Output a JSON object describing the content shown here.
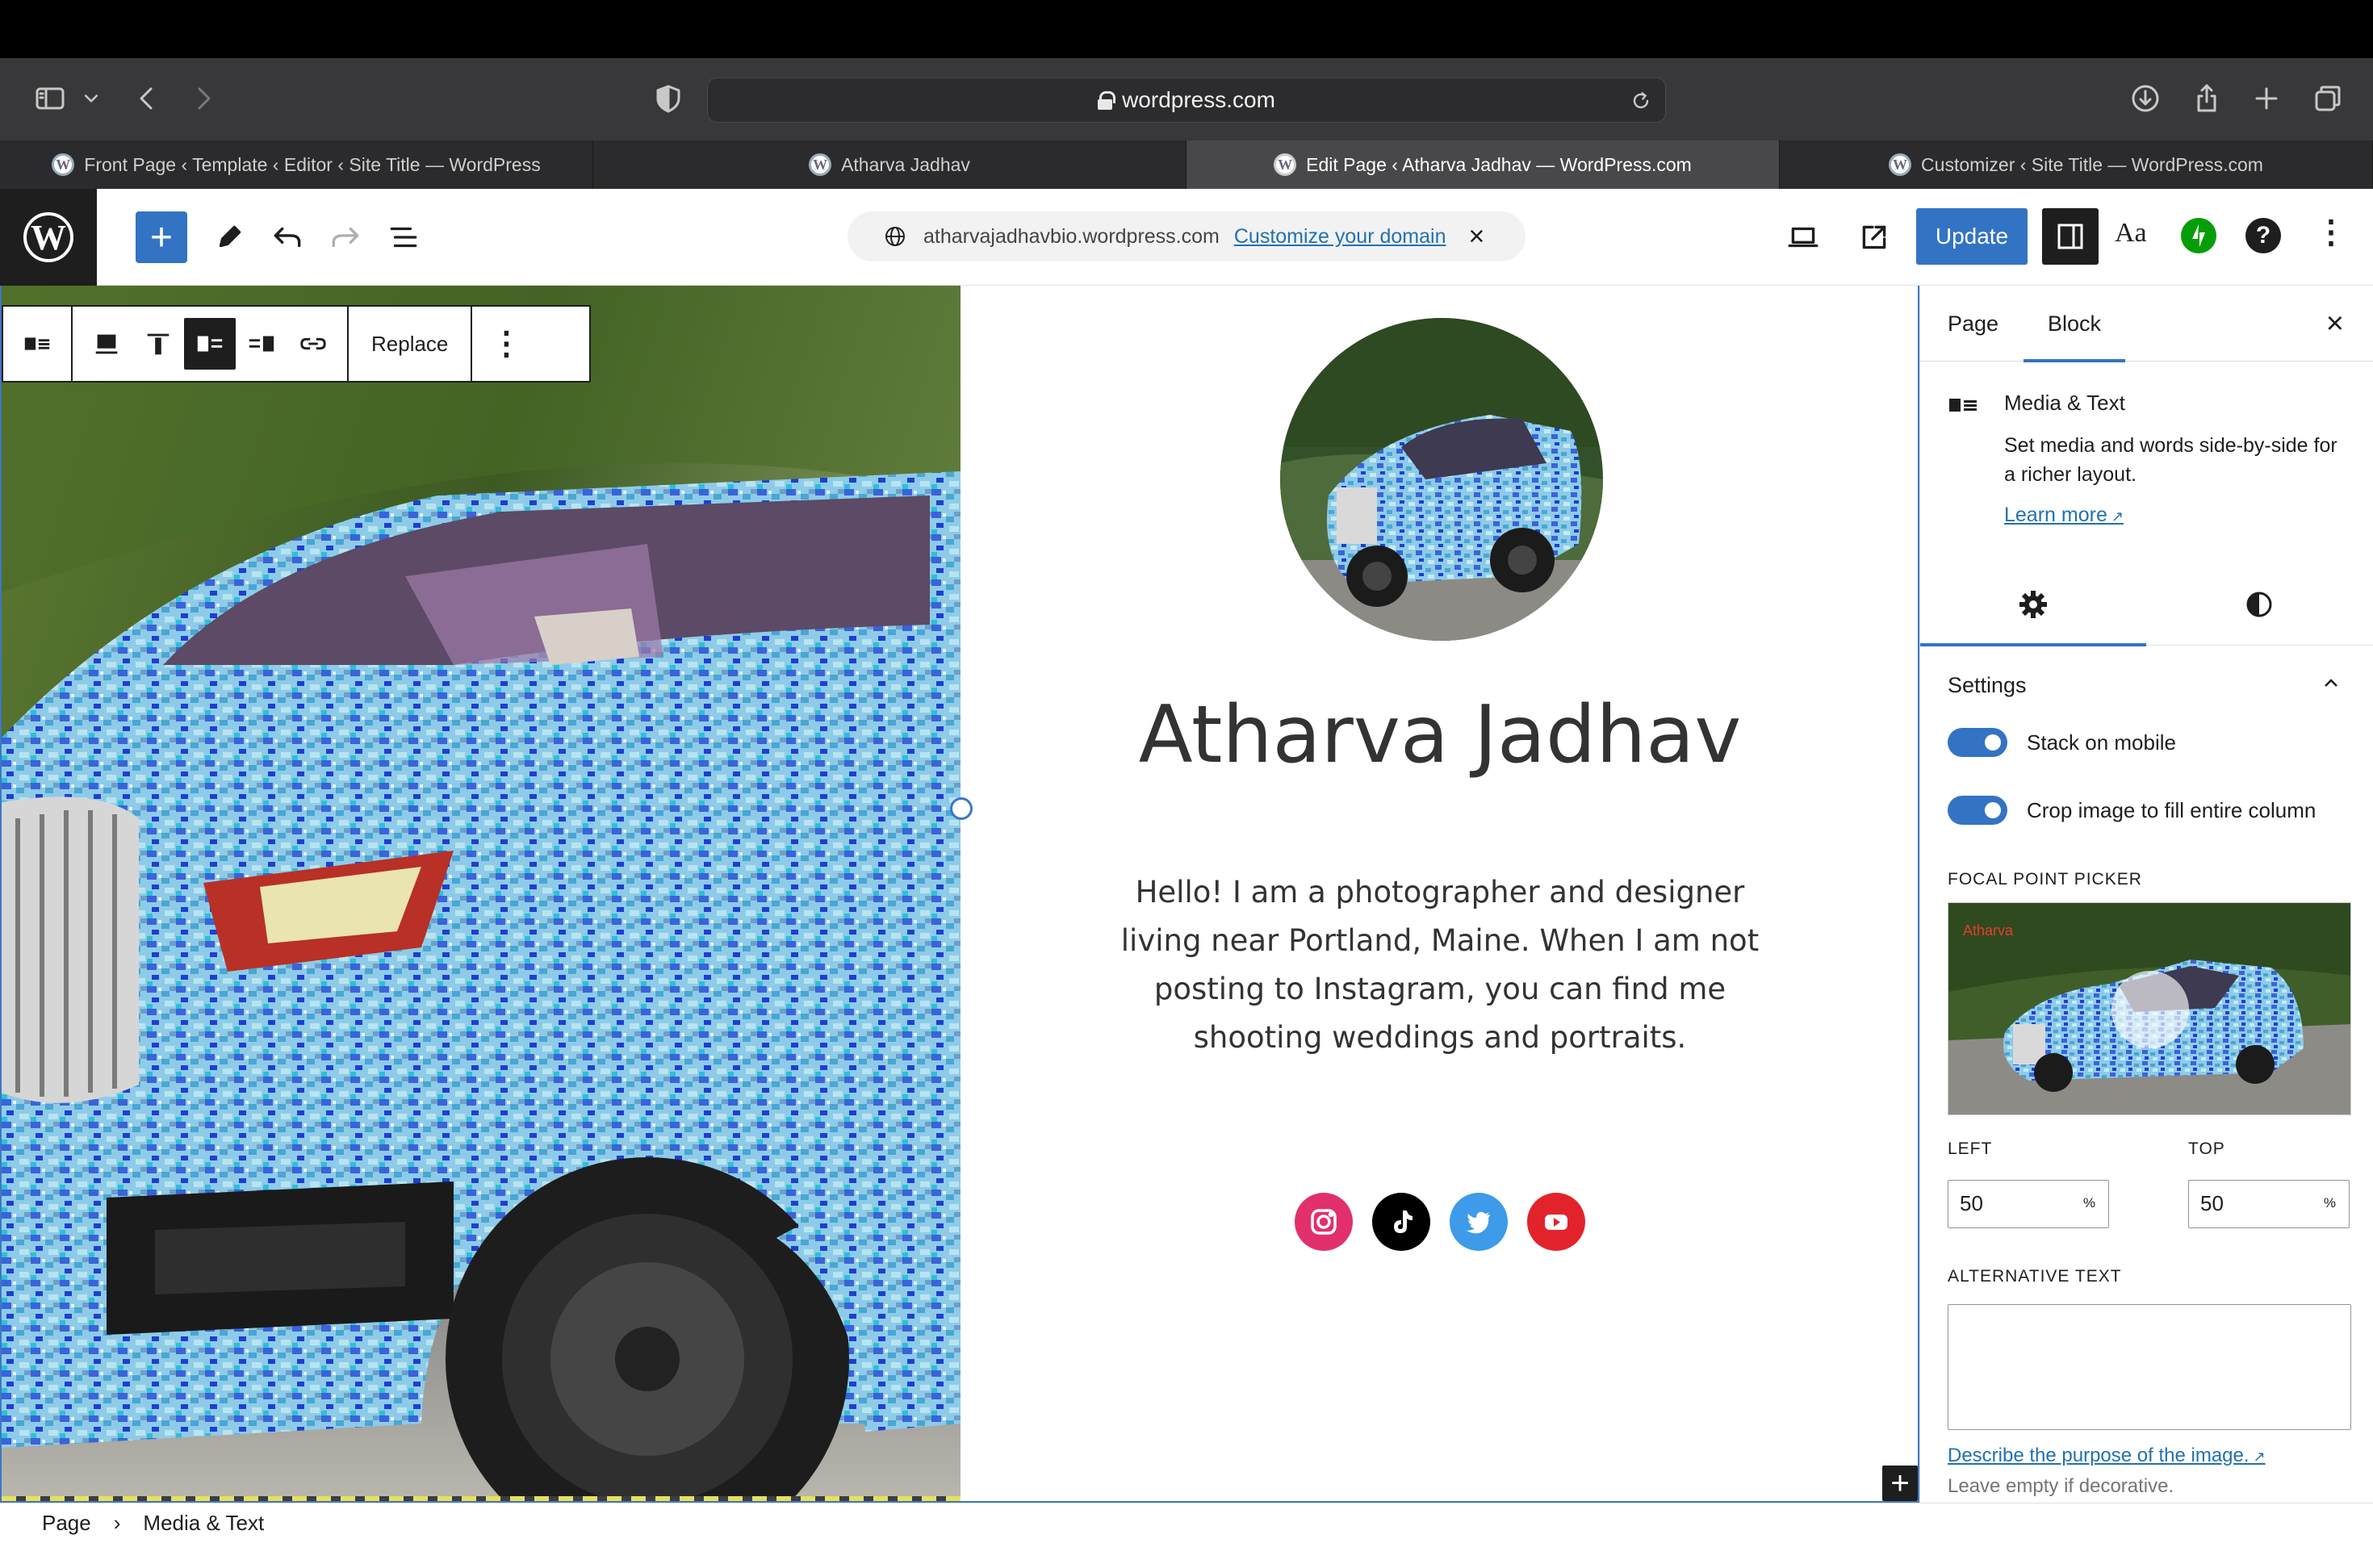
{
  "browser": {
    "url": "wordpress.com",
    "tabs": [
      {
        "label": "Front Page ‹ Template ‹ Editor ‹ Site Title — WordPress"
      },
      {
        "label": "Atharva Jadhav"
      },
      {
        "label": "Edit Page ‹ Atharva Jadhav — WordPress.com"
      },
      {
        "label": "Customizer ‹ Site Title — WordPress.com"
      }
    ],
    "icons": [
      "sidebar-icon",
      "chevron-down-icon",
      "back-icon",
      "forward-icon",
      "shield-icon",
      "reload-icon",
      "download-icon",
      "share-icon",
      "new-tab-icon",
      "tabs-overview-icon"
    ]
  },
  "editor": {
    "domain_text": "atharvajadhavbio.wordpress.com",
    "customize_link": "Customize your domain",
    "update_label": "Update",
    "styles_label": "Aa"
  },
  "block_toolbar": {
    "replace_label": "Replace"
  },
  "content": {
    "name": "Atharva Jadhav",
    "bio": "Hello! I am a photographer and designer living near Portland, Maine. When I am not posting to Instagram, you can find me shooting weddings and portraits.",
    "socials": [
      "instagram-icon",
      "tiktok-icon",
      "twitter-icon",
      "youtube-icon"
    ]
  },
  "sidebar": {
    "tabs": {
      "page": "Page",
      "block": "Block"
    },
    "block_title": "Media & Text",
    "block_desc": "Set media and words side-by-side for a richer layout.",
    "learn_more": "Learn more",
    "settings_title": "Settings",
    "toggles": {
      "stack": "Stack on mobile",
      "crop": "Crop image to fill entire column"
    },
    "focal_label": "FOCAL POINT PICKER",
    "focal_watermark": "Atharva",
    "left_label": "LEFT",
    "top_label": "TOP",
    "left_value": "50",
    "top_value": "50",
    "percent": "%",
    "alt_label": "ALTERNATIVE TEXT",
    "alt_link": "Describe the purpose of the image.",
    "alt_help": "Leave empty if decorative."
  },
  "breadcrumb": {
    "root": "Page",
    "current": "Media & Text"
  },
  "colors": {
    "accent": "#3373c4",
    "link": "#2271b1"
  }
}
